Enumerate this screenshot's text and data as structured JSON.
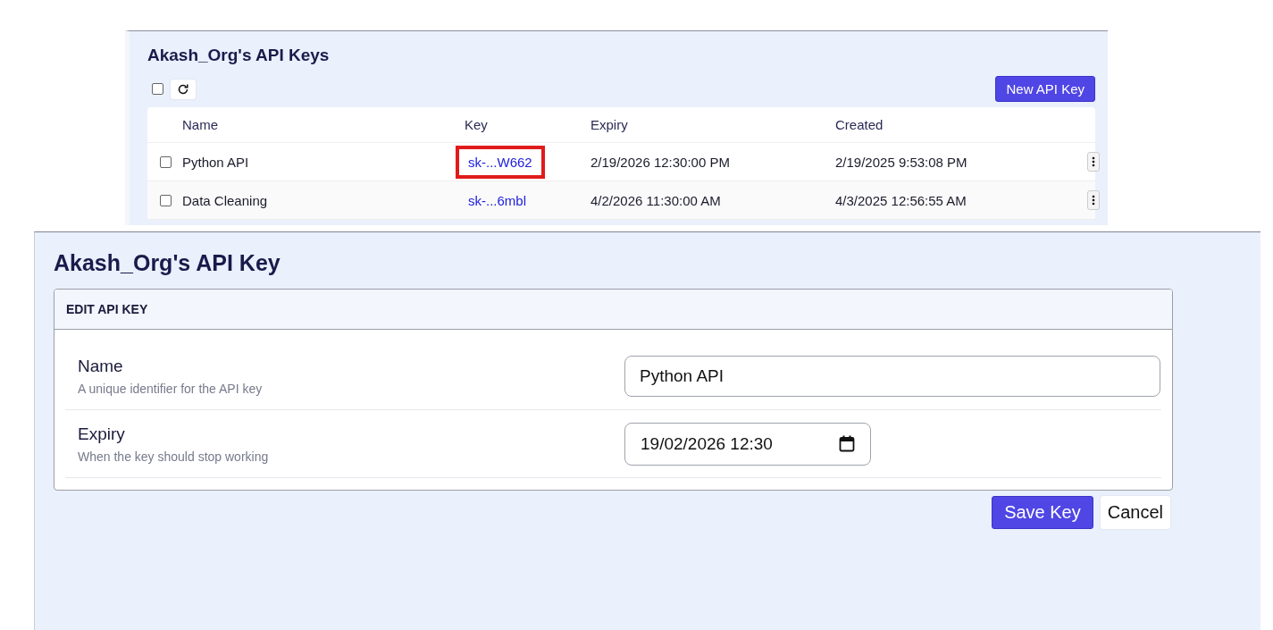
{
  "keys_list": {
    "title": "Akash_Org's API Keys",
    "select_all": {
      "checked": false
    },
    "new_button": "New API Key",
    "columns": [
      "Name",
      "Key",
      "Expiry",
      "Created"
    ],
    "rows": [
      {
        "name": "Python API",
        "key": "sk-...W662",
        "expiry": "2/19/2026 12:30:00 PM",
        "created": "2/19/2025 9:53:08 PM",
        "checked": false,
        "highlighted": true
      },
      {
        "name": "Data Cleaning",
        "key": "sk-...6mbl",
        "expiry": "4/2/2026 11:30:00 AM",
        "created": "4/3/2025 12:56:55 AM",
        "checked": false,
        "highlighted": false
      }
    ]
  },
  "edit_page": {
    "title": "Akash_Org's API Key",
    "card_title": "EDIT API KEY",
    "fields": [
      {
        "kind": "text",
        "label": "Name",
        "hint": "A unique identifier for the API key",
        "value": "Python API"
      },
      {
        "kind": "datetime",
        "label": "Expiry",
        "hint": "When the key should stop working",
        "value": "19/02/2026 12:30"
      }
    ],
    "buttons": [
      {
        "kind": "primary",
        "label": "Save Key"
      },
      {
        "kind": "secondary",
        "label": "Cancel"
      }
    ]
  }
}
